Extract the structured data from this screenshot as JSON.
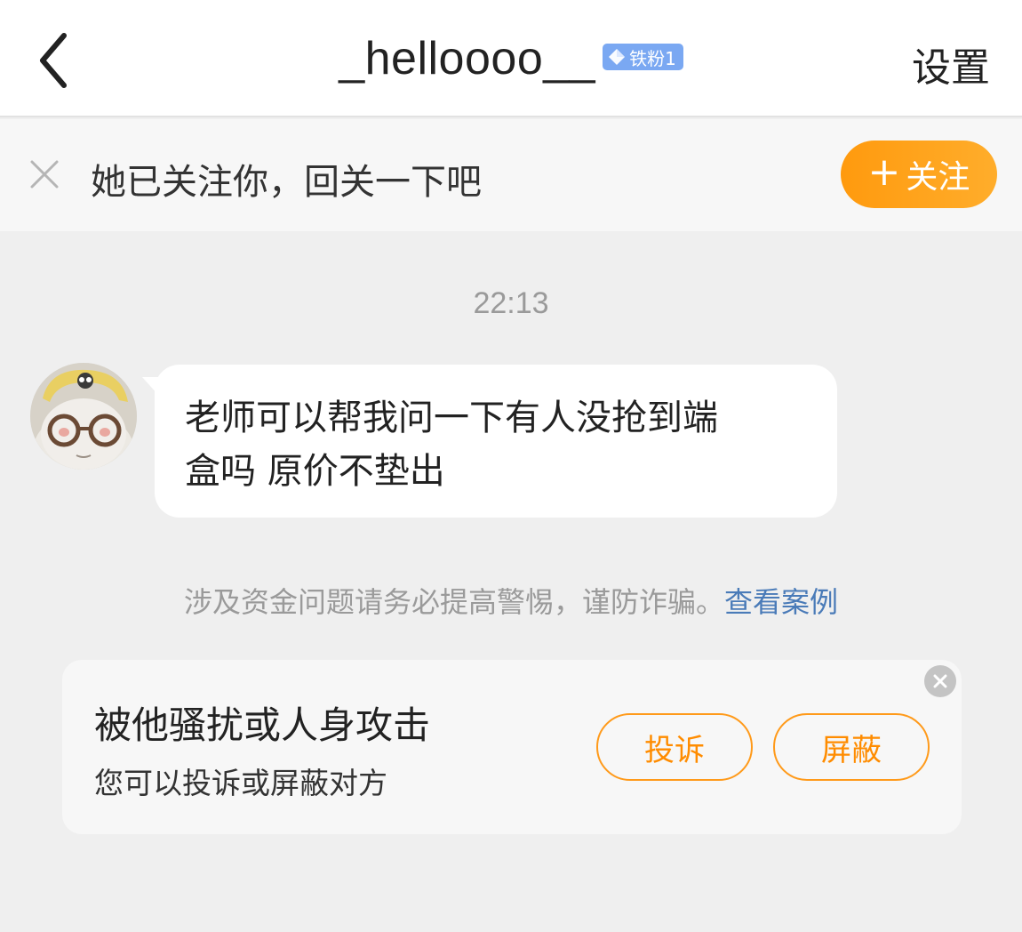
{
  "header": {
    "title": "_helloooo__",
    "badge": "铁粉1",
    "settings_label": "设置",
    "back_icon": "chevron-left-icon"
  },
  "follow_bar": {
    "message": "她已关注你，回关一下吧",
    "follow_label": "关注",
    "follow_plus": "+",
    "close_icon": "close-icon"
  },
  "chat": {
    "timestamp": "22:13",
    "messages": [
      {
        "sender": "other",
        "lines": [
          "老师可以帮我问一下有人没抢到端",
          "盒吗 原价不垫出"
        ]
      }
    ]
  },
  "warning": {
    "text": "涉及资金问题请务必提高警惕，谨防诈骗。",
    "link": "查看案例"
  },
  "report_card": {
    "title": "被他骚扰或人身攻击",
    "subtitle": "您可以投诉或屏蔽对方",
    "complain_label": "投诉",
    "block_label": "屏蔽"
  },
  "colors": {
    "accent": "#ff9a0e",
    "link": "#4a7bb8",
    "badge": "#7aa8f2",
    "background": "#efefef"
  }
}
